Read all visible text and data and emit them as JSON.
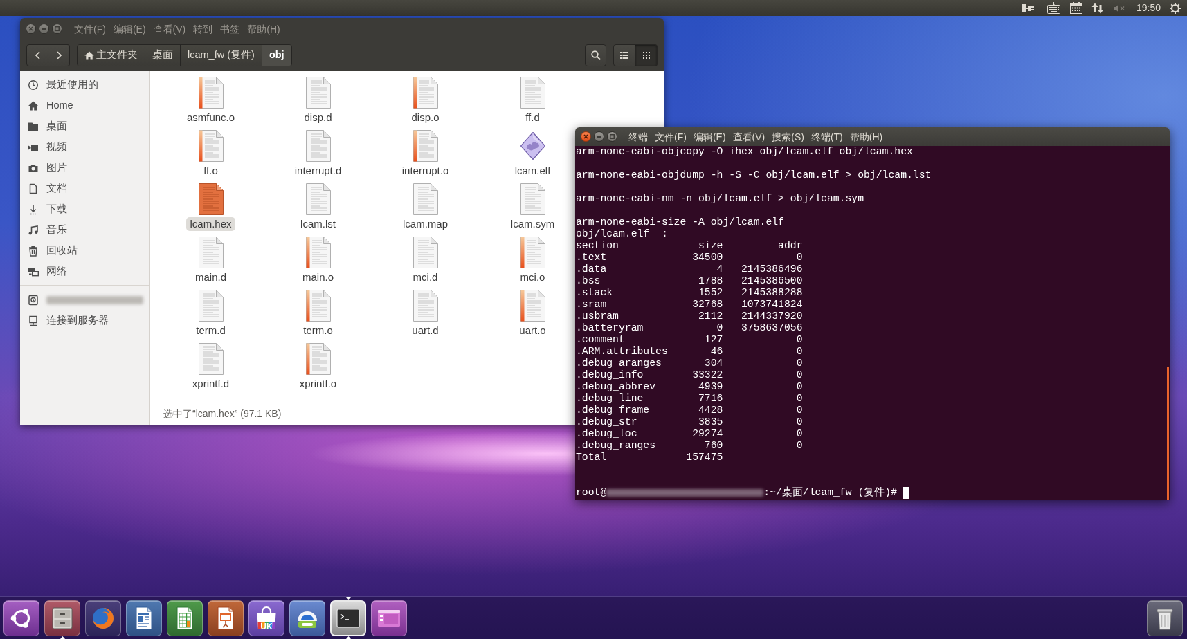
{
  "top_panel": {
    "clock": "19:50"
  },
  "file_manager": {
    "active": false,
    "menu": [
      "文件(F)",
      "编辑(E)",
      "查看(V)",
      "转到",
      "书签",
      "帮助(H)"
    ],
    "path": [
      {
        "kind": "home",
        "label": "主文件夹",
        "selected": false
      },
      {
        "kind": "folder",
        "label": "桌面",
        "selected": false
      },
      {
        "kind": "folder",
        "label": "lcam_fw (复件)",
        "selected": false
      },
      {
        "kind": "folder",
        "label": "obj",
        "selected": true
      }
    ],
    "views": [
      {
        "kind": "list",
        "selected": false
      },
      {
        "kind": "grid",
        "selected": true
      }
    ],
    "sidebar": [
      {
        "items": [
          {
            "kind": "recent",
            "label": "最近使用的"
          },
          {
            "kind": "home",
            "label": "Home"
          },
          {
            "kind": "desktop",
            "label": "桌面"
          },
          {
            "kind": "videos",
            "label": "视频"
          },
          {
            "kind": "pictures",
            "label": "图片"
          },
          {
            "kind": "documents",
            "label": "文档"
          },
          {
            "kind": "downloads",
            "label": "下载"
          },
          {
            "kind": "music",
            "label": "音乐"
          },
          {
            "kind": "trash",
            "label": "回收站"
          },
          {
            "kind": "network",
            "label": "网络"
          }
        ]
      },
      {
        "items": [
          {
            "kind": "drive",
            "blurred": true
          },
          {
            "kind": "server",
            "label": "连接到服务器"
          }
        ]
      }
    ],
    "files": [
      {
        "name": "asmfunc.o",
        "kind": "object",
        "selected": false
      },
      {
        "name": "disp.d",
        "kind": "text",
        "selected": false
      },
      {
        "name": "disp.o",
        "kind": "object",
        "selected": false
      },
      {
        "name": "ff.d",
        "kind": "text",
        "selected": false
      },
      {
        "name": "ff.o",
        "kind": "object",
        "selected": false
      },
      {
        "name": "interrupt.d",
        "kind": "text",
        "selected": false
      },
      {
        "name": "interrupt.o",
        "kind": "object",
        "selected": false
      },
      {
        "name": "lcam.elf",
        "kind": "executable",
        "selected": false
      },
      {
        "name": "lcam.hex",
        "kind": "text",
        "selected": true
      },
      {
        "name": "lcam.lst",
        "kind": "text",
        "selected": false
      },
      {
        "name": "lcam.map",
        "kind": "text",
        "selected": false
      },
      {
        "name": "lcam.sym",
        "kind": "text",
        "selected": false
      },
      {
        "name": "main.d",
        "kind": "text",
        "selected": false
      },
      {
        "name": "main.o",
        "kind": "object",
        "selected": false
      },
      {
        "name": "mci.d",
        "kind": "text",
        "selected": false
      },
      {
        "name": "mci.o",
        "kind": "object",
        "selected": false
      },
      {
        "name": "term.d",
        "kind": "text",
        "selected": false
      },
      {
        "name": "term.o",
        "kind": "object",
        "selected": false
      },
      {
        "name": "uart.d",
        "kind": "text",
        "selected": false
      },
      {
        "name": "uart.o",
        "kind": "object",
        "selected": false
      },
      {
        "name": "xprintf.d",
        "kind": "text",
        "selected": false
      },
      {
        "name": "xprintf.o",
        "kind": "object",
        "selected": false
      }
    ],
    "status": "选中了“lcam.hex” (97.1 KB)"
  },
  "terminal": {
    "active": true,
    "menu": [
      "终端",
      "文件(F)",
      "编辑(E)",
      "查看(V)",
      "搜索(S)",
      "终端(T)",
      "帮助(H)"
    ],
    "commands": [
      "arm-none-eabi-objcopy -O ihex obj/lcam.elf obj/lcam.hex",
      "arm-none-eabi-objdump -h -S -C obj/lcam.elf > obj/lcam.lst",
      "arm-none-eabi-nm -n obj/lcam.elf > obj/lcam.sym"
    ],
    "size_command": "arm-none-eabi-size -A obj/lcam.elf",
    "file_header": "obj/lcam.elf  :",
    "table": {
      "columns": [
        "section",
        "size",
        "addr"
      ],
      "rows": [
        {
          "section": ".text",
          "size": "34500",
          "addr": "0"
        },
        {
          "section": ".data",
          "size": "4",
          "addr": "2145386496"
        },
        {
          "section": ".bss",
          "size": "1788",
          "addr": "2145386500"
        },
        {
          "section": ".stack",
          "size": "1552",
          "addr": "2145388288"
        },
        {
          "section": ".sram",
          "size": "32768",
          "addr": "1073741824"
        },
        {
          "section": ".usbram",
          "size": "2112",
          "addr": "2144337920"
        },
        {
          "section": ".batteryram",
          "size": "0",
          "addr": "3758637056"
        },
        {
          "section": ".comment",
          "size": "127",
          "addr": "0"
        },
        {
          "section": ".ARM.attributes",
          "size": "46",
          "addr": "0"
        },
        {
          "section": ".debug_aranges",
          "size": "304",
          "addr": "0"
        },
        {
          "section": ".debug_info",
          "size": "33322",
          "addr": "0"
        },
        {
          "section": ".debug_abbrev",
          "size": "4939",
          "addr": "0"
        },
        {
          "section": ".debug_line",
          "size": "7716",
          "addr": "0"
        },
        {
          "section": ".debug_frame",
          "size": "4428",
          "addr": "0"
        },
        {
          "section": ".debug_str",
          "size": "3835",
          "addr": "0"
        },
        {
          "section": ".debug_loc",
          "size": "29274",
          "addr": "0"
        },
        {
          "section": ".debug_ranges",
          "size": "760",
          "addr": "0"
        }
      ]
    },
    "total": {
      "label": "Total",
      "size": "157475"
    },
    "prompt": {
      "user": "root@",
      "host_blurred": true,
      "path": ":~/桌面/lcam_fw (复件)#",
      "cursor": true
    }
  },
  "dock": {
    "launchers": [
      {
        "kind": "dash",
        "running": false,
        "focused": false
      },
      {
        "kind": "files",
        "running": true,
        "focused": false
      },
      {
        "kind": "browser",
        "running": false,
        "focused": false
      },
      {
        "kind": "writer",
        "running": false,
        "focused": false
      },
      {
        "kind": "calc",
        "running": false,
        "focused": false
      },
      {
        "kind": "impress",
        "running": false,
        "focused": false
      },
      {
        "kind": "software",
        "text": "UK",
        "running": false,
        "focused": false
      },
      {
        "kind": "assistant",
        "running": false,
        "focused": false
      },
      {
        "kind": "terminal",
        "running": true,
        "focused": true
      },
      {
        "kind": "workspaces",
        "running": false,
        "focused": false
      }
    ],
    "end": [
      {
        "kind": "trash",
        "running": false,
        "focused": false
      }
    ]
  }
}
